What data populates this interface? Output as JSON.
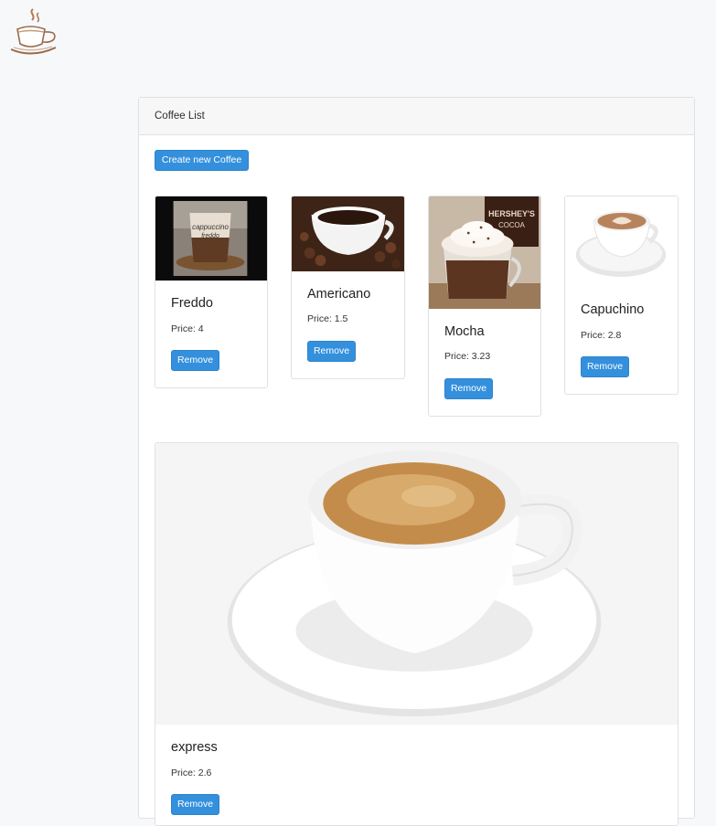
{
  "app": {
    "logo_icon": "coffee-cup-logo-icon"
  },
  "panel": {
    "title": "Coffee List"
  },
  "actions": {
    "create_label": "Create new Coffee"
  },
  "colors": {
    "primary": "#3490dc",
    "panel_header": "#f7f7f7",
    "background": "#f7f8fa"
  },
  "coffees": [
    {
      "name": "Freddo",
      "price": "Price: 4",
      "remove_label": "Remove"
    },
    {
      "name": "Americano",
      "price": "Price: 1.5",
      "remove_label": "Remove"
    },
    {
      "name": "Mocha",
      "price": "Price: 3.23",
      "remove_label": "Remove"
    },
    {
      "name": "Capuchino",
      "price": "Price: 2.8",
      "remove_label": "Remove"
    },
    {
      "name": "express",
      "price": "Price: 2.6",
      "remove_label": "Remove"
    }
  ]
}
